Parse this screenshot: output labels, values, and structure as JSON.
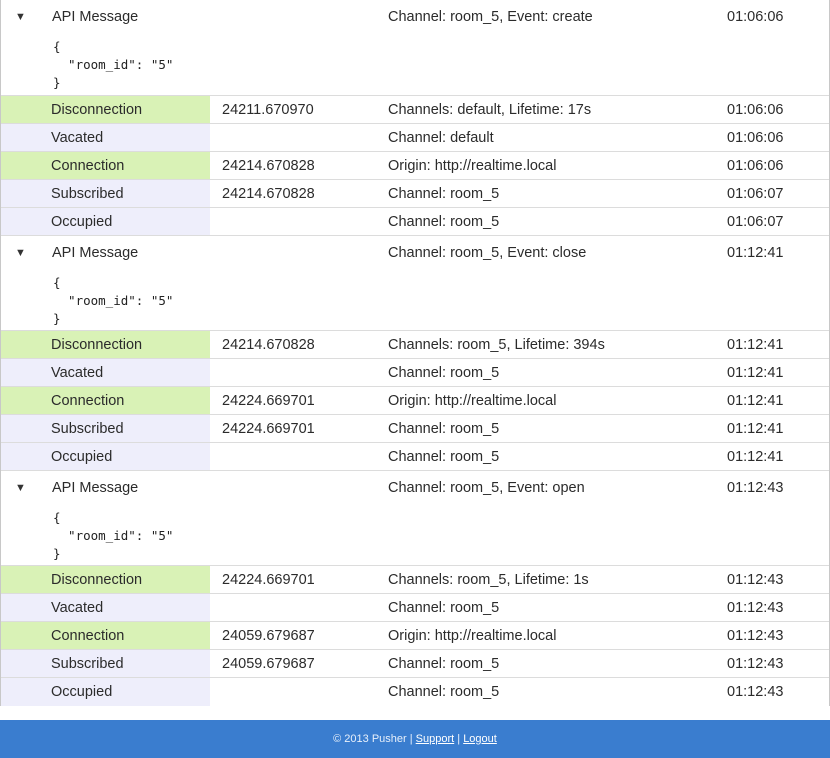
{
  "groups": [
    {
      "api": {
        "toggle": "▼",
        "label": "API Message",
        "details": "Channel: room_5, Event: create",
        "time": "01:06:06",
        "json_lines": [
          "{",
          "  \"room_id\": \"5\"",
          "}"
        ]
      },
      "events": [
        {
          "type": "Disconnection",
          "id": "24211.670970",
          "details": "Channels: default, Lifetime: 17s",
          "time": "01:06:06"
        },
        {
          "type": "Vacated",
          "id": "",
          "details": "Channel: default",
          "time": "01:06:06"
        },
        {
          "type": "Connection",
          "id": "24214.670828",
          "details": "Origin: http://realtime.local",
          "time": "01:06:06"
        },
        {
          "type": "Subscribed",
          "id": "24214.670828",
          "details": "Channel: room_5",
          "time": "01:06:07"
        },
        {
          "type": "Occupied",
          "id": "",
          "details": "Channel: room_5",
          "time": "01:06:07"
        }
      ]
    },
    {
      "api": {
        "toggle": "▼",
        "label": "API Message",
        "details": "Channel: room_5, Event: close",
        "time": "01:12:41",
        "json_lines": [
          "{",
          "  \"room_id\": \"5\"",
          "}"
        ]
      },
      "events": [
        {
          "type": "Disconnection",
          "id": "24214.670828",
          "details": "Channels: room_5, Lifetime: 394s",
          "time": "01:12:41"
        },
        {
          "type": "Vacated",
          "id": "",
          "details": "Channel: room_5",
          "time": "01:12:41"
        },
        {
          "type": "Connection",
          "id": "24224.669701",
          "details": "Origin: http://realtime.local",
          "time": "01:12:41"
        },
        {
          "type": "Subscribed",
          "id": "24224.669701",
          "details": "Channel: room_5",
          "time": "01:12:41"
        },
        {
          "type": "Occupied",
          "id": "",
          "details": "Channel: room_5",
          "time": "01:12:41"
        }
      ]
    },
    {
      "api": {
        "toggle": "▼",
        "label": "API Message",
        "details": "Channel: room_5, Event: open",
        "time": "01:12:43",
        "json_lines": [
          "{",
          "  \"room_id\": \"5\"",
          "}"
        ]
      },
      "events": [
        {
          "type": "Disconnection",
          "id": "24224.669701",
          "details": "Channels: room_5, Lifetime: 1s",
          "time": "01:12:43"
        },
        {
          "type": "Vacated",
          "id": "",
          "details": "Channel: room_5",
          "time": "01:12:43"
        },
        {
          "type": "Connection",
          "id": "24059.679687",
          "details": "Origin: http://realtime.local",
          "time": "01:12:43"
        },
        {
          "type": "Subscribed",
          "id": "24059.679687",
          "details": "Channel: room_5",
          "time": "01:12:43"
        },
        {
          "type": "Occupied",
          "id": "",
          "details": "Channel: room_5",
          "time": "01:12:43"
        }
      ]
    }
  ],
  "colors": {
    "connection": "#d9f2b6",
    "subscription": "#eeeefb",
    "footer": "#3a7dcf"
  },
  "footer": {
    "copyright": "© 2013 Pusher",
    "sep1": "|",
    "support": "Support",
    "sep2": "|",
    "logout": "Logout"
  }
}
